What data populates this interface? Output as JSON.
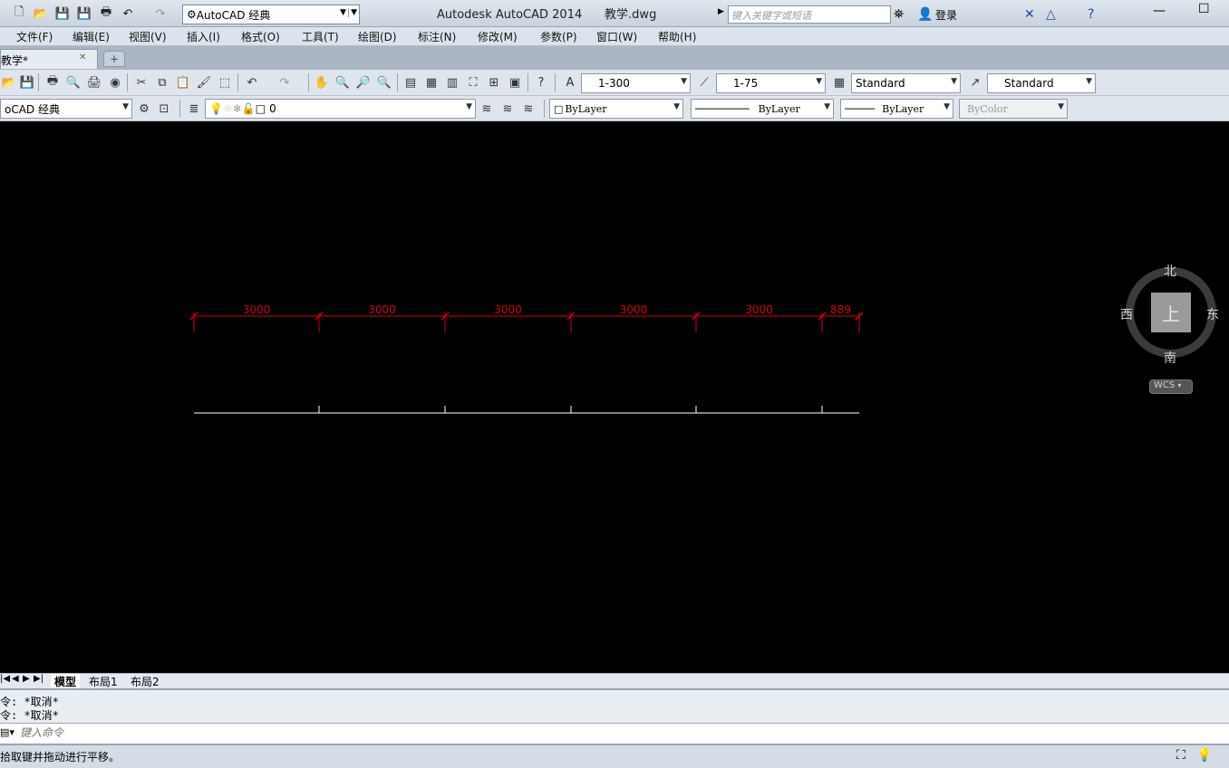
{
  "title": {
    "app": "Autodesk AutoCAD 2014",
    "file": "教学.dwg",
    "workspace": "AutoCAD 经典",
    "search_placeholder": "键入关键字或短语",
    "signin": "登录"
  },
  "menu": [
    "文件(F)",
    "编辑(E)",
    "视图(V)",
    "插入(I)",
    "格式(O)",
    "工具(T)",
    "绘图(D)",
    "标注(N)",
    "修改(M)",
    "参数(P)",
    "窗口(W)",
    "帮助(H)"
  ],
  "doc_tab": {
    "label": "教学*"
  },
  "toolbar1": {
    "text_scale": "1-300",
    "annotation_scale": "1-75",
    "text_style": "Standard",
    "table_style": "Standard"
  },
  "toolbar2": {
    "workspace": "oCAD 经典",
    "layer": "0",
    "color": "ByLayer",
    "linetype": "ByLayer",
    "lineweight": "ByLayer",
    "plotstyle": "ByColor"
  },
  "viewcube": {
    "north": "北",
    "south": "南",
    "east": "东",
    "west": "西",
    "top": "上",
    "wcs": "WCS"
  },
  "drawing": {
    "dimensions": [
      "3000",
      "3000",
      "3000",
      "3000",
      "3000",
      "889"
    ],
    "dim_color": "#d2000f",
    "line_color": "#ffffff"
  },
  "layout_tabs": [
    "模型",
    "布局1",
    "布局2"
  ],
  "command_history": [
    "令: *取消*",
    "令: *取消*"
  ],
  "command_placeholder": "键入命令",
  "status": "拾取键并拖动进行平移。"
}
